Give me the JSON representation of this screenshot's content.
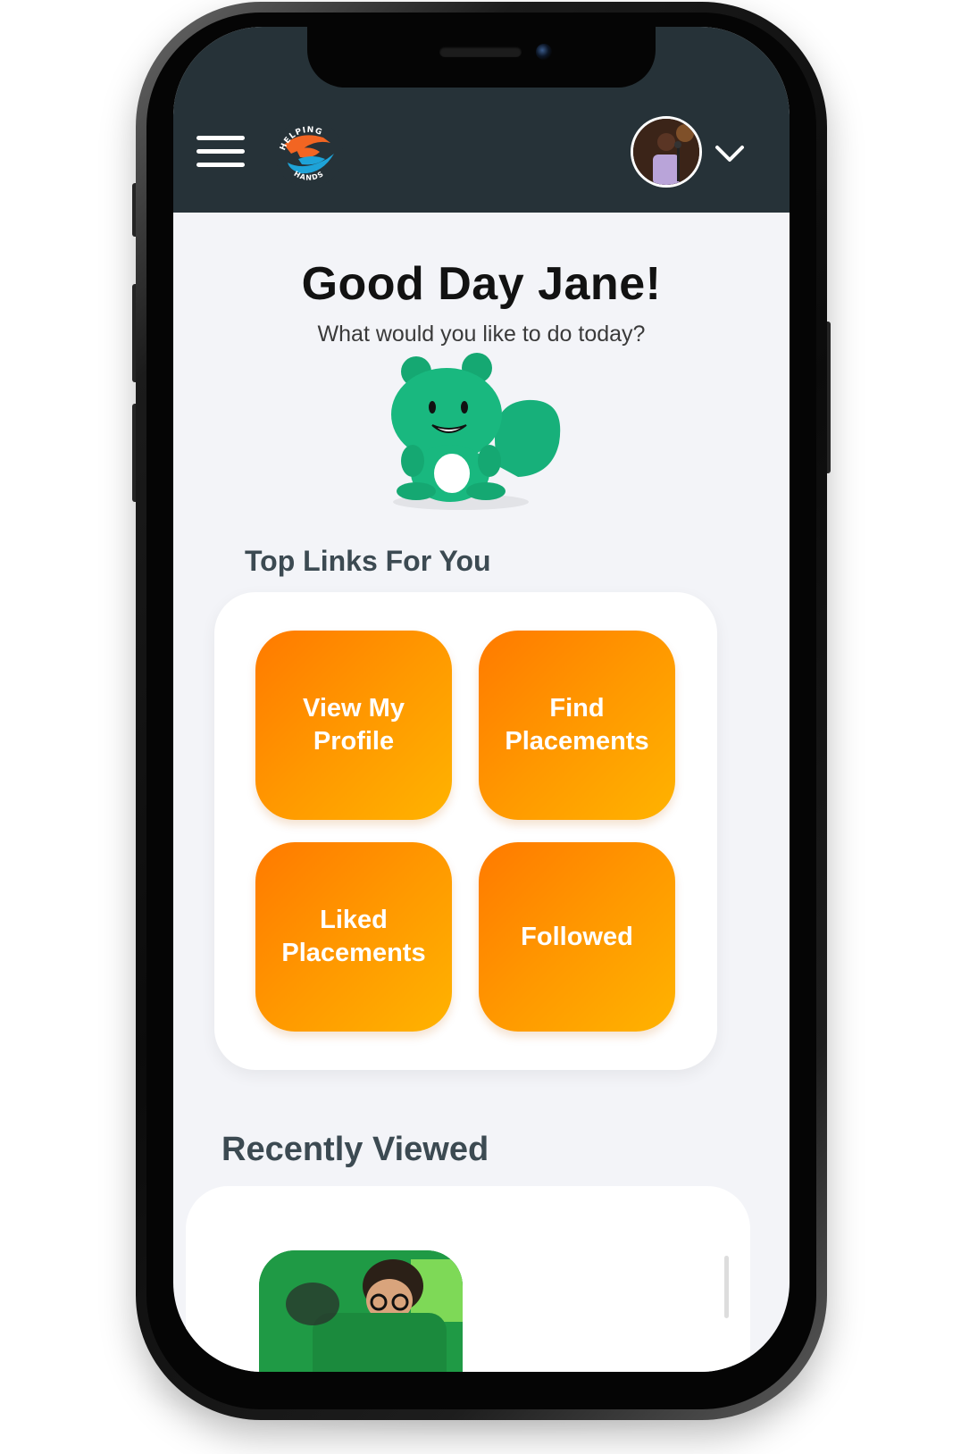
{
  "header": {
    "menu_icon": "hamburger-menu-icon",
    "logo": {
      "name": "helping-hands-logo",
      "text_top": "HELPING",
      "text_bottom": "HANDS"
    },
    "avatar_icon": "user-avatar",
    "dropdown_icon": "chevron-down-icon"
  },
  "greeting": {
    "title": "Good Day Jane!",
    "subtitle": "What would you like to do today?"
  },
  "mascot_icon": "green-squirrel-mascot-icon",
  "top_links": {
    "title": "Top Links For You",
    "tiles": [
      {
        "label": "View My Profile"
      },
      {
        "label": "Find Placements"
      },
      {
        "label": "Liked Placements"
      },
      {
        "label": "Followed"
      }
    ]
  },
  "recently_viewed": {
    "title": "Recently Viewed"
  },
  "colors": {
    "header_bg": "#263238",
    "tile_gradient_start": "#ff7a00",
    "tile_gradient_end": "#ffb300",
    "mascot_green": "#16b277",
    "screen_bg": "#f3f4f8"
  }
}
